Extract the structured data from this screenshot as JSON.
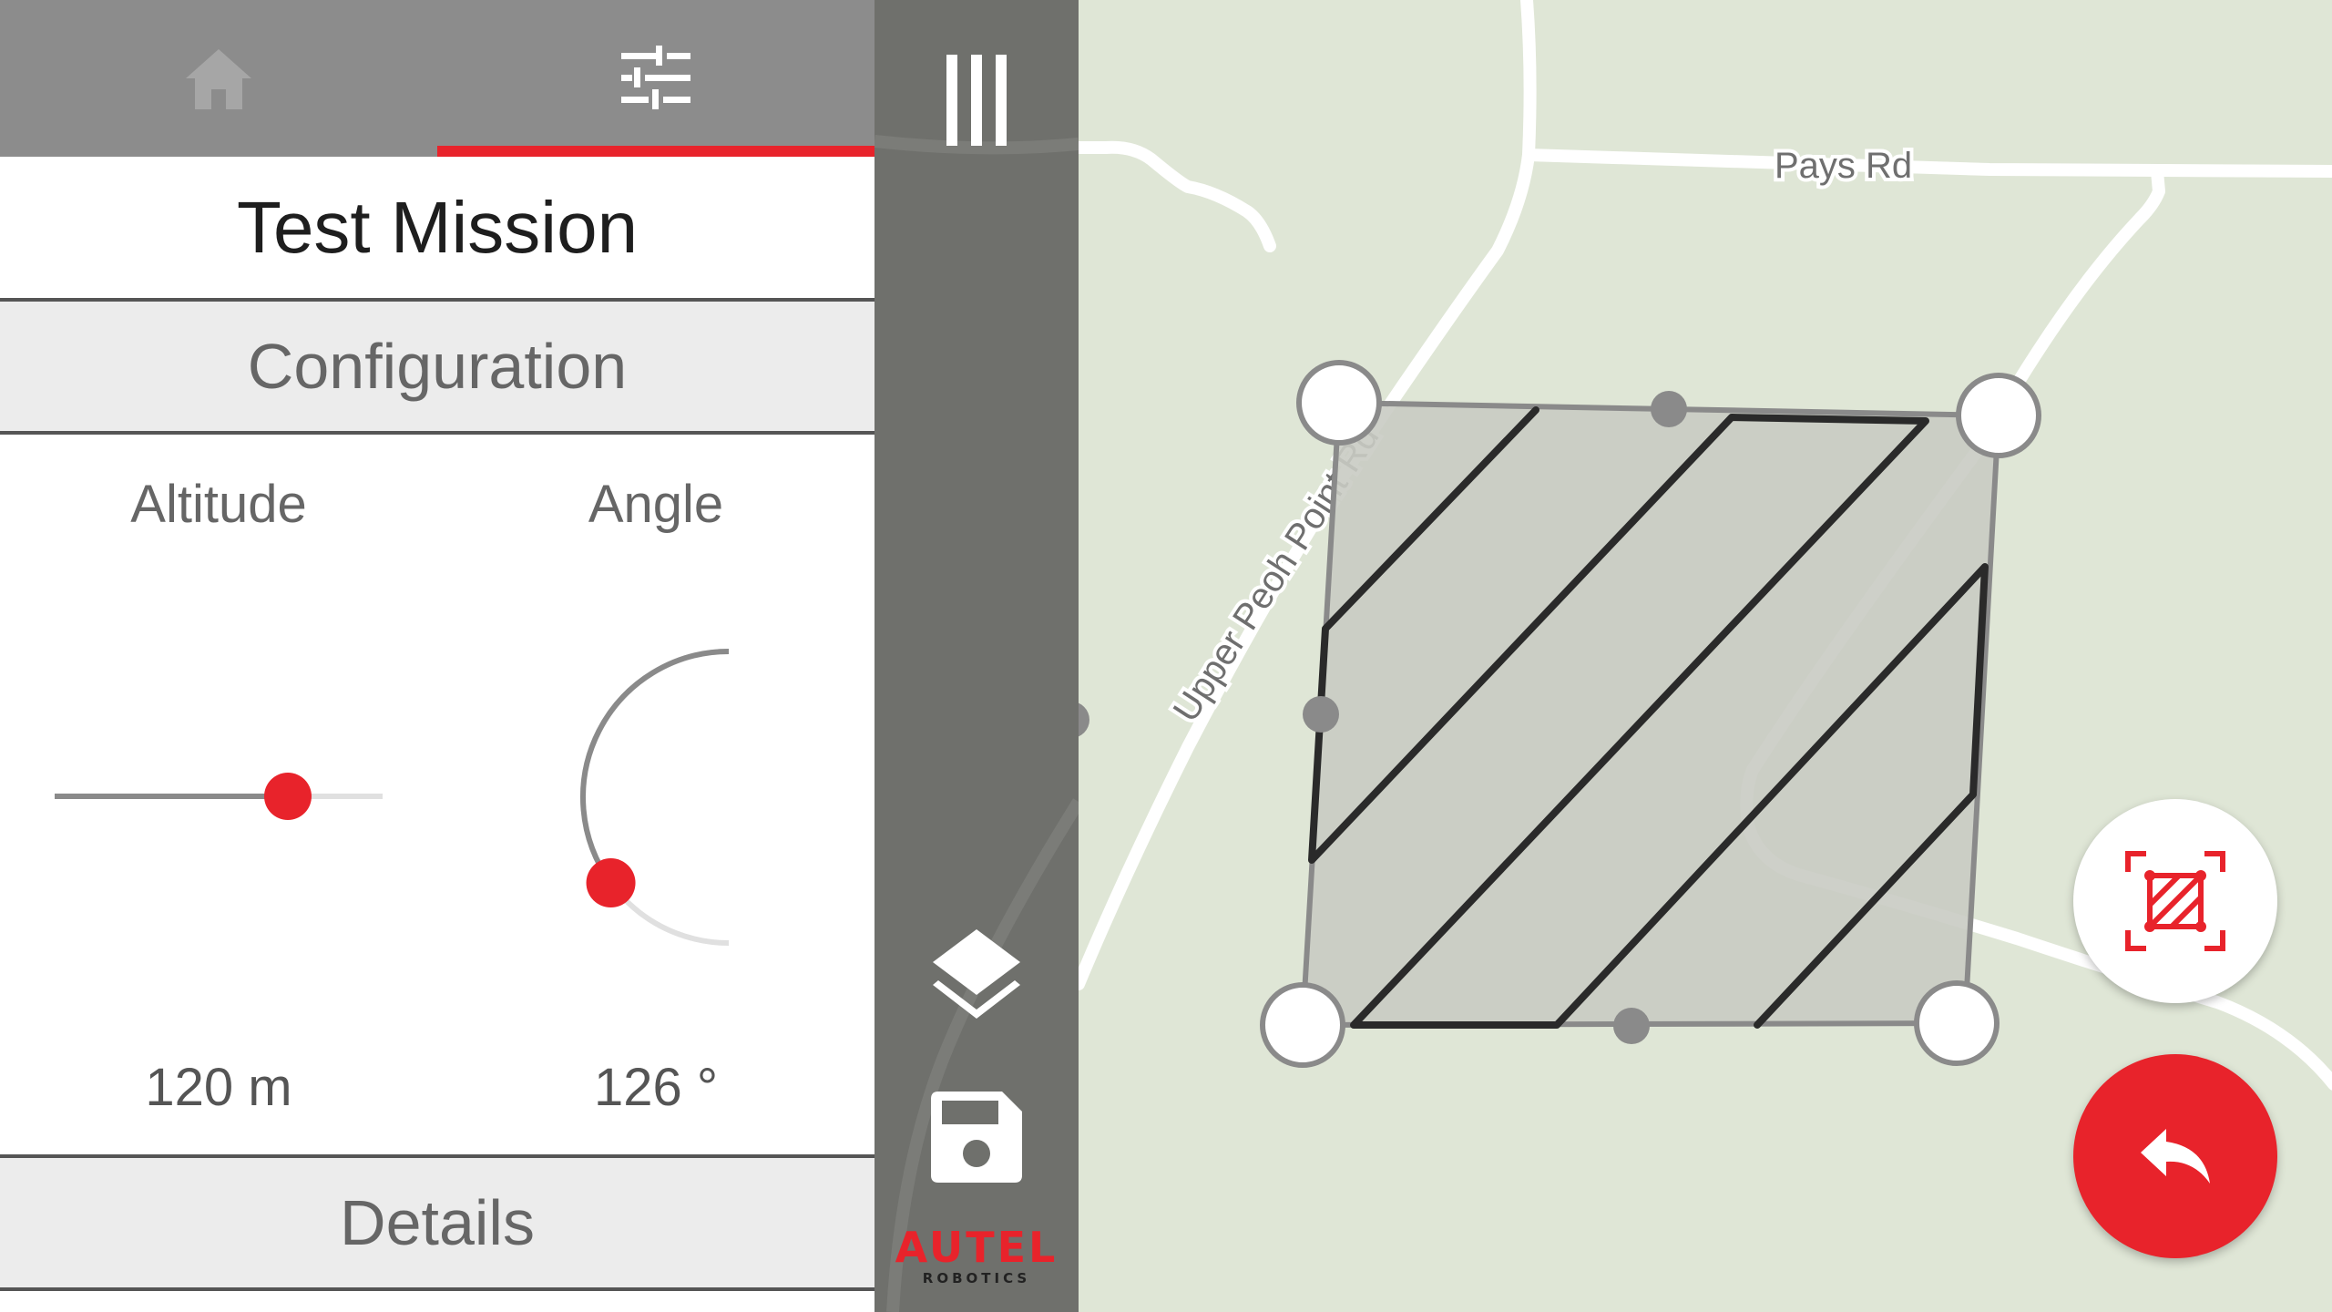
{
  "tabs": [
    {
      "icon": "home-icon",
      "active": false
    },
    {
      "icon": "sliders-icon",
      "active": true
    }
  ],
  "mission": {
    "title": "Test Mission"
  },
  "configuration": {
    "header": "Configuration",
    "altitude": {
      "label": "Altitude",
      "value": "120 m",
      "level": 0.71
    },
    "angle": {
      "label": "Angle",
      "value": "126 °",
      "degrees": 126
    }
  },
  "details": {
    "header": "Details"
  },
  "toolbar": {
    "icons": [
      "menu-icon",
      "layers-icon",
      "save-icon"
    ],
    "brand": {
      "name": "AUTEL",
      "sub": "ROBOTICS"
    }
  },
  "map": {
    "roads": [
      {
        "name": "Pays Rd"
      },
      {
        "name": "Upper Peoh Point Rd"
      }
    ]
  },
  "colors": {
    "accent": "#e8232b",
    "tab_bar": "#8c8c8c",
    "toolbar": "#6f706c",
    "map_land": "#dfe6d6",
    "survey_area": "#c9cbc3"
  },
  "fabs": [
    {
      "icon": "survey-area-icon"
    },
    {
      "icon": "undo-icon"
    }
  ]
}
